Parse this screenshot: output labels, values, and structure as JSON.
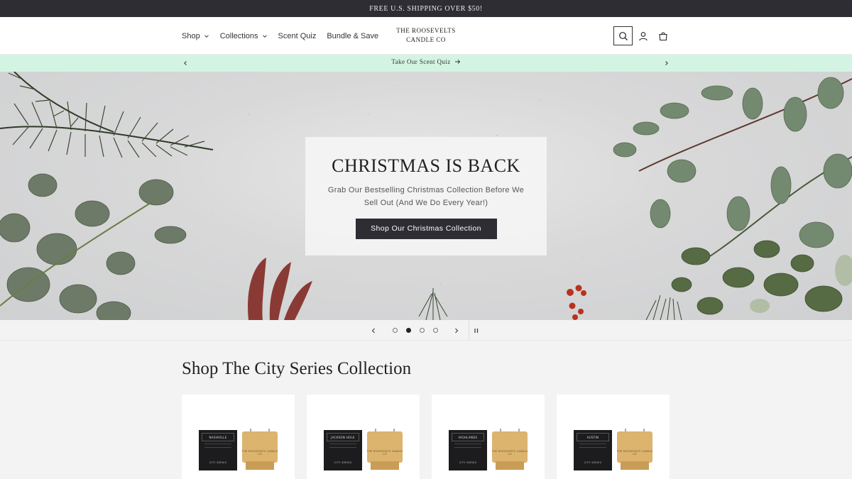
{
  "announcement": "FREE U.S. SHIPPING OVER $50!",
  "nav": {
    "shop": "Shop",
    "collections": "Collections",
    "scent_quiz": "Scent Quiz",
    "bundle_save": "Bundle & Save"
  },
  "logo": {
    "line1": "THE ROOSEVELTS",
    "line2": "CANDLE CO"
  },
  "header_icons": [
    "search-icon",
    "account-icon",
    "cart-icon"
  ],
  "promo": {
    "text": "Take Our Scent Quiz",
    "arrow": "→",
    "bg_color": "#d3f4e2"
  },
  "hero": {
    "title": "CHRISTMAS IS BACK",
    "subtitle": "Grab Our Bestselling Christmas Collection Before We Sell Out (And We Do Every Year!)",
    "button": "Shop Our Christmas Collection",
    "slides_total": 4,
    "active_slide": 2
  },
  "section": {
    "title": "Shop The City Series Collection"
  },
  "products": [
    {
      "box_label": "NASHVILLE",
      "series": "CITY SERIES",
      "jar_text": "THE ROOSEVELTS CANDLE CO"
    },
    {
      "box_label": "JACKSON HOLE",
      "series": "CITY SERIES",
      "jar_text": "THE ROOSEVELTS CANDLE CO"
    },
    {
      "box_label": "HIGHLANDS",
      "series": "CITY SERIES",
      "jar_text": "THE ROOSEVELTS CANDLE CO"
    },
    {
      "box_label": "AUSTIN",
      "series": "CITY SERIES",
      "jar_text": "THE ROOSEVELTS CANDLE CO"
    }
  ],
  "colors": {
    "dark": "#2d2d33",
    "background": "#f3f3f3",
    "candle_gold": "#d9b06a"
  }
}
